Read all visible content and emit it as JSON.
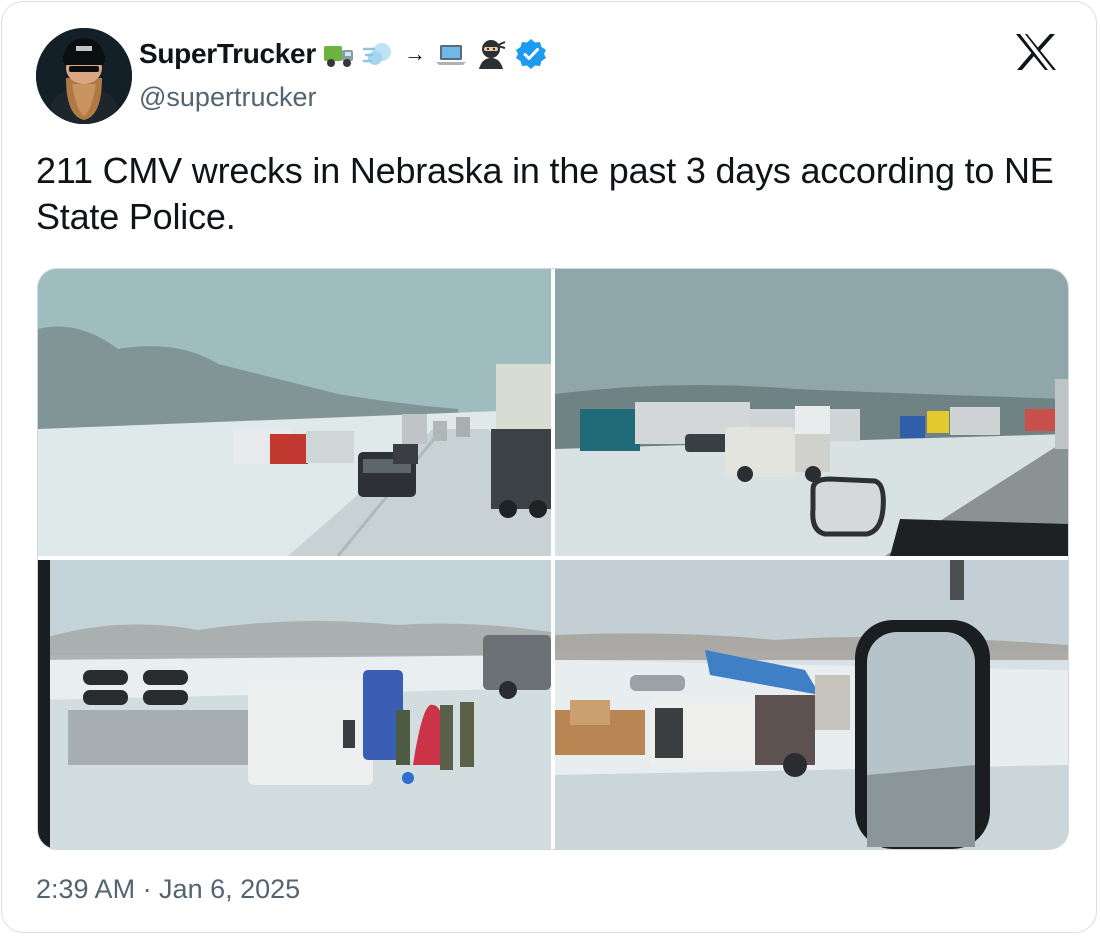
{
  "tweet": {
    "author": {
      "display_name": "SuperTrucker",
      "handle": "@supertrucker",
      "name_emojis": [
        "truck-emoji",
        "dash-emoji",
        "arrow-emoji",
        "laptop-emoji",
        "ninja-emoji"
      ],
      "arrow_glyph": "→",
      "verified": true,
      "verified_color": "#1d9bf0"
    },
    "text": "211 CMV wrecks in Nebraska in the past 3 days according to NE State Police.",
    "timestamp": "2:39 AM · Jan 6, 2025",
    "platform_icon": "x-logo-icon",
    "media": [
      {
        "name": "photo-highway-snow-trucks",
        "kind": "photo"
      },
      {
        "name": "photo-truck-in-median",
        "kind": "photo"
      },
      {
        "name": "photo-overturned-trailer",
        "kind": "photo"
      },
      {
        "name": "photo-wrecked-truck-mirror",
        "kind": "photo"
      }
    ]
  },
  "colors": {
    "text_primary": "#0f1419",
    "text_secondary": "#536471",
    "border": "#cfd9de"
  }
}
